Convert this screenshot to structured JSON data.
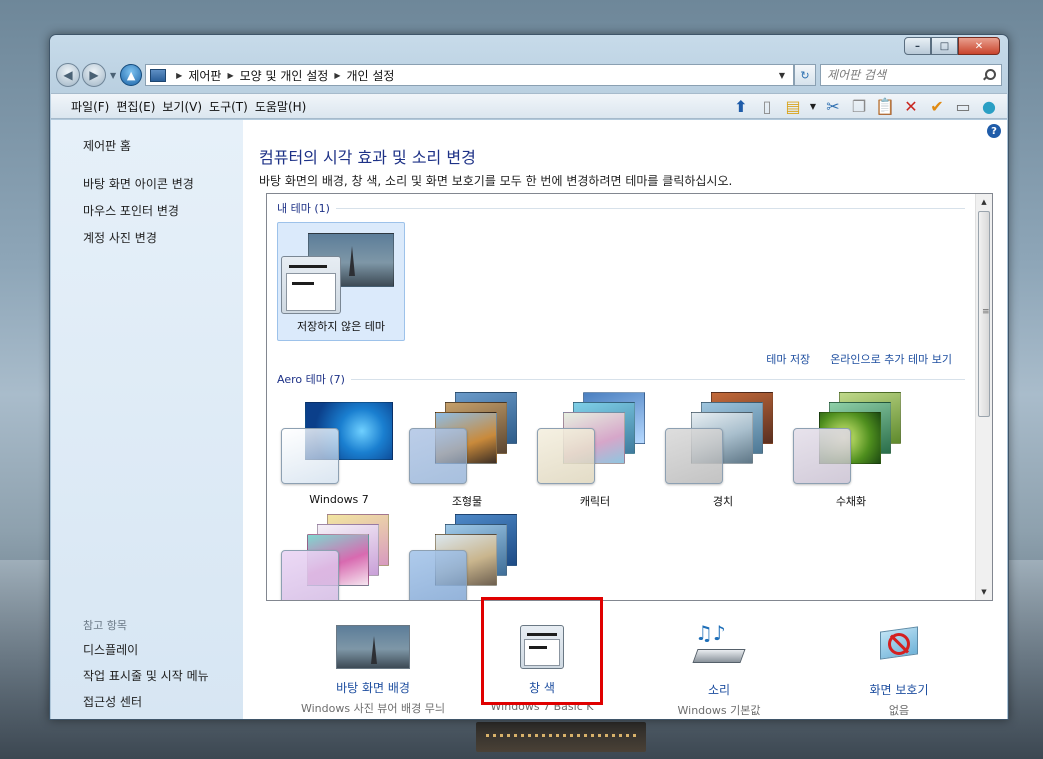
{
  "address": {
    "crumbs": [
      "제어판",
      "모양 및 개인 설정",
      "개인 설정"
    ],
    "search_placeholder": "제어판 검색"
  },
  "menu": [
    "파일(F)",
    "편집(E)",
    "보기(V)",
    "도구(T)",
    "도움말(H)"
  ],
  "left_pane": {
    "home": "제어판 홈",
    "links": [
      "바탕 화면 아이콘 변경",
      "마우스 포인터 변경",
      "계정 사진 변경"
    ],
    "see_also_label": "참고 항목",
    "see_also": [
      "디스플레이",
      "작업 표시줄 및 시작 메뉴",
      "접근성 센터"
    ]
  },
  "main": {
    "title": "컴퓨터의 시각 효과 및 소리 변경",
    "description": "바탕 화면의 배경, 창 색, 소리 및 화면 보호기를 모두 한 번에 변경하려면 테마를 클릭하십시오.",
    "my_themes_header": "내 테마 (1)",
    "unsaved_theme": "저장하지 않은 테마",
    "save_theme": "테마 저장",
    "online_themes": "온라인으로 추가 테마 보기",
    "aero_header": "Aero 테마 (7)",
    "aero_themes": [
      "Windows 7",
      "조형물",
      "캐릭터",
      "경치",
      "수채화"
    ]
  },
  "bottom": {
    "background": {
      "name": "바탕 화면 배경",
      "value": "Windows 사진 뷰어 배경 무늬"
    },
    "color": {
      "name": "창 색",
      "value": "Windows 7 Basic K"
    },
    "sound": {
      "name": "소리",
      "value": "Windows 기본값"
    },
    "screensaver": {
      "name": "화면 보호기",
      "value": "없음"
    }
  },
  "colors": {
    "link": "#1f4fa0",
    "title": "#1e3287",
    "highlight_border": "#e00000"
  }
}
